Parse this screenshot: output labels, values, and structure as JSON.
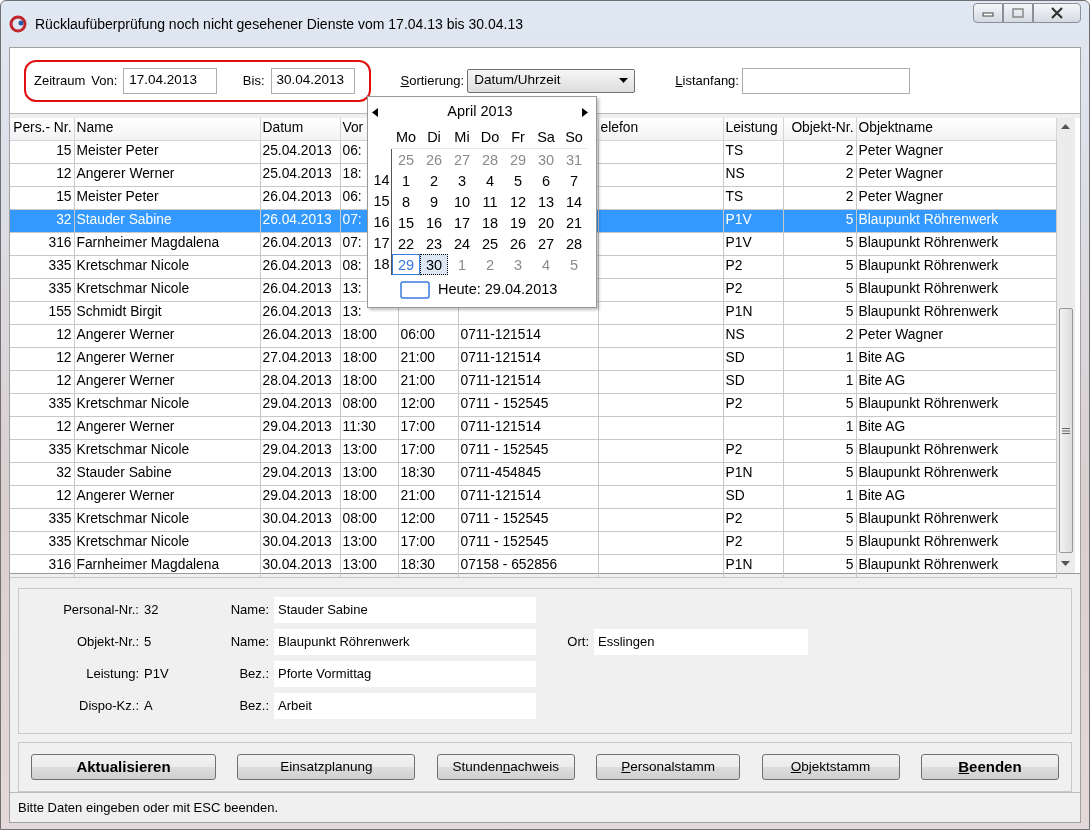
{
  "window": {
    "title": "Rücklaufüberprüfung noch nicht gesehener Dienste vom 17.04.13 bis 30.04.13"
  },
  "filter": {
    "period_label": "Zeitraum",
    "from_label": "Von:",
    "from_value": "17.04.2013",
    "to_label": "Bis:",
    "to_value": "30.04.2013",
    "sort_label": [
      {
        "text": "S",
        "underline": true
      },
      {
        "text": "ortierung:",
        "underline": false
      }
    ],
    "sort_value": "Datum/Uhrzeit",
    "list_start_label": [
      {
        "text": "L",
        "underline": true
      },
      {
        "text": "istanfang:",
        "underline": false
      }
    ]
  },
  "table": {
    "columns": [
      {
        "label": "Pers.- Nr."
      },
      {
        "label": "Name"
      },
      {
        "label": "Datum"
      },
      {
        "label": "Vor"
      },
      {},
      {},
      {
        "label": "elefon"
      },
      {
        "label": "Leistung"
      },
      {
        "label": "Objekt-Nr."
      },
      {
        "label": "Objektname"
      }
    ],
    "rows": [
      {
        "selected": false,
        "cells": [
          "15",
          "Meister Peter",
          "25.04.2013",
          "06:",
          null,
          null,
          null,
          "TS",
          "2",
          "Peter Wagner"
        ]
      },
      {
        "selected": false,
        "cells": [
          "12",
          "Angerer Werner",
          "25.04.2013",
          "18:",
          null,
          null,
          null,
          "NS",
          "2",
          "Peter Wagner"
        ]
      },
      {
        "selected": false,
        "cells": [
          "15",
          "Meister Peter",
          "26.04.2013",
          "06:",
          null,
          null,
          null,
          "TS",
          "2",
          "Peter Wagner"
        ]
      },
      {
        "selected": true,
        "cells": [
          "32",
          "Stauder Sabine",
          "26.04.2013",
          "07:",
          null,
          null,
          null,
          "P1V",
          "5",
          "Blaupunkt Röhrenwerk"
        ]
      },
      {
        "selected": false,
        "cells": [
          "316",
          "Farnheimer Magdalena",
          "26.04.2013",
          "07:",
          null,
          null,
          null,
          "P1V",
          "5",
          "Blaupunkt Röhrenwerk"
        ]
      },
      {
        "selected": false,
        "cells": [
          "335",
          "Kretschmar Nicole",
          "26.04.2013",
          "08:",
          null,
          null,
          null,
          "P2",
          "5",
          "Blaupunkt Röhrenwerk"
        ]
      },
      {
        "selected": false,
        "cells": [
          "335",
          "Kretschmar Nicole",
          "26.04.2013",
          "13:",
          null,
          null,
          null,
          "P2",
          "5",
          "Blaupunkt Röhrenwerk"
        ]
      },
      {
        "selected": false,
        "cells": [
          "155",
          "Schmidt Birgit",
          "26.04.2013",
          "13:",
          null,
          null,
          null,
          "P1N",
          "5",
          "Blaupunkt Röhrenwerk"
        ]
      },
      {
        "selected": false,
        "cells": [
          "12",
          "Angerer Werner",
          "26.04.2013",
          "18:00",
          "06:00",
          "0711-121514",
          null,
          "NS",
          "2",
          "Peter Wagner"
        ]
      },
      {
        "selected": false,
        "cells": [
          "12",
          "Angerer Werner",
          "27.04.2013",
          "18:00",
          "21:00",
          "0711-121514",
          null,
          "SD",
          "1",
          "Bite AG"
        ]
      },
      {
        "selected": false,
        "cells": [
          "12",
          "Angerer Werner",
          "28.04.2013",
          "18:00",
          "21:00",
          "0711-121514",
          null,
          "SD",
          "1",
          "Bite AG"
        ]
      },
      {
        "selected": false,
        "cells": [
          "335",
          "Kretschmar Nicole",
          "29.04.2013",
          "08:00",
          "12:00",
          "0711 - 152545",
          null,
          "P2",
          "5",
          "Blaupunkt Röhrenwerk"
        ]
      },
      {
        "selected": false,
        "cells": [
          "12",
          "Angerer Werner",
          "29.04.2013",
          "11:30",
          "17:00",
          "0711-121514",
          null,
          null,
          "1",
          "Bite AG"
        ]
      },
      {
        "selected": false,
        "cells": [
          "335",
          "Kretschmar Nicole",
          "29.04.2013",
          "13:00",
          "17:00",
          "0711 - 152545",
          null,
          "P2",
          "5",
          "Blaupunkt Röhrenwerk"
        ]
      },
      {
        "selected": false,
        "cells": [
          "32",
          "Stauder Sabine",
          "29.04.2013",
          "13:00",
          "18:30",
          "0711-454845",
          null,
          "P1N",
          "5",
          "Blaupunkt Röhrenwerk"
        ]
      },
      {
        "selected": false,
        "cells": [
          "12",
          "Angerer Werner",
          "29.04.2013",
          "18:00",
          "21:00",
          "0711-121514",
          null,
          "SD",
          "1",
          "Bite AG"
        ]
      },
      {
        "selected": false,
        "cells": [
          "335",
          "Kretschmar Nicole",
          "30.04.2013",
          "08:00",
          "12:00",
          "0711 - 152545",
          null,
          "P2",
          "5",
          "Blaupunkt Röhrenwerk"
        ]
      },
      {
        "selected": false,
        "cells": [
          "335",
          "Kretschmar Nicole",
          "30.04.2013",
          "13:00",
          "17:00",
          "0711 - 152545",
          null,
          "P2",
          "5",
          "Blaupunkt Röhrenwerk"
        ]
      },
      {
        "selected": false,
        "cells": [
          "316",
          "Farnheimer Magdalena",
          "30.04.2013",
          "13:00",
          "18:30",
          "07158 - 652856",
          null,
          "P1N",
          "5",
          "Blaupunkt Röhrenwerk"
        ]
      }
    ]
  },
  "calendar": {
    "month_label": "April 2013",
    "weekdays": [
      "Mo",
      "Di",
      "Mi",
      "Do",
      "Fr",
      "Sa",
      "So"
    ],
    "weeks": [
      {
        "days": [
          {
            "label": "25",
            "muted": true
          },
          {
            "label": "26",
            "muted": true
          },
          {
            "label": "27",
            "muted": true
          },
          {
            "label": "28",
            "muted": true
          },
          {
            "label": "29",
            "muted": true
          },
          {
            "label": "30",
            "muted": true
          },
          {
            "label": "31",
            "muted": true
          }
        ]
      },
      {
        "number": "14",
        "days": [
          {
            "label": "1"
          },
          {
            "label": "2"
          },
          {
            "label": "3"
          },
          {
            "label": "4"
          },
          {
            "label": "5"
          },
          {
            "label": "6"
          },
          {
            "label": "7"
          }
        ]
      },
      {
        "number": "15",
        "days": [
          {
            "label": "8"
          },
          {
            "label": "9"
          },
          {
            "label": "10"
          },
          {
            "label": "11"
          },
          {
            "label": "12"
          },
          {
            "label": "13"
          },
          {
            "label": "14"
          }
        ]
      },
      {
        "number": "16",
        "days": [
          {
            "label": "15"
          },
          {
            "label": "16"
          },
          {
            "label": "17"
          },
          {
            "label": "18"
          },
          {
            "label": "19"
          },
          {
            "label": "20"
          },
          {
            "label": "21"
          }
        ]
      },
      {
        "number": "17",
        "days": [
          {
            "label": "22"
          },
          {
            "label": "23"
          },
          {
            "label": "24"
          },
          {
            "label": "25"
          },
          {
            "label": "26"
          },
          {
            "label": "27"
          },
          {
            "label": "28"
          }
        ]
      },
      {
        "number": "18",
        "days": [
          {
            "label": "29",
            "today": true
          },
          {
            "label": "30",
            "selected": true
          },
          {
            "label": "1",
            "muted": true
          },
          {
            "label": "2",
            "muted": true
          },
          {
            "label": "3",
            "muted": true
          },
          {
            "label": "4",
            "muted": true
          },
          {
            "label": "5",
            "muted": true
          }
        ]
      }
    ],
    "today_label": "Heute: 29.04.2013"
  },
  "details": {
    "rows": [
      [
        {
          "label": "Personal-Nr.:",
          "value": "32",
          "kind": "plain"
        },
        {
          "label": "Name:",
          "value": "Stauder Sabine",
          "kind": "field"
        }
      ],
      [
        {
          "label": "Objekt-Nr.:",
          "value": "5",
          "kind": "plain"
        },
        {
          "label": "Name:",
          "value": "Blaupunkt Röhrenwerk",
          "kind": "field"
        },
        {
          "label": "Ort:",
          "value": "Esslingen",
          "kind": "field"
        }
      ],
      [
        {
          "label": "Leistung:",
          "value": "P1V",
          "kind": "plain"
        },
        {
          "label": "Bez.:",
          "value": "Pforte  Vormittag",
          "kind": "field"
        }
      ],
      [
        {
          "label": "Dispo-Kz.:",
          "value": "A",
          "kind": "plain"
        },
        {
          "label": "Bez.:",
          "value": "Arbeit",
          "kind": "field"
        }
      ]
    ]
  },
  "buttons": [
    {
      "label": [
        {
          "text": "Aktualisieren",
          "underline": false
        }
      ],
      "bold": true
    },
    {
      "label": [
        {
          "text": "Einsatzplanung",
          "underline": false
        }
      ],
      "bold": false
    },
    {
      "label": [
        {
          "text": "Stunden",
          "underline": false
        },
        {
          "text": "n",
          "underline": true
        },
        {
          "text": "achweis",
          "underline": false
        }
      ],
      "bold": false
    },
    {
      "label": [
        {
          "text": "P",
          "underline": true
        },
        {
          "text": "ersonalstamm",
          "underline": false
        }
      ],
      "bold": false
    },
    {
      "label": [
        {
          "text": "O",
          "underline": true
        },
        {
          "text": "bjektstamm",
          "underline": false
        }
      ],
      "bold": false
    },
    {
      "label": [
        {
          "text": "B",
          "underline": true
        },
        {
          "text": "eenden",
          "underline": false
        }
      ],
      "bold": true
    }
  ],
  "status_bar": "Bitte Daten eingeben oder mit ESC beenden."
}
